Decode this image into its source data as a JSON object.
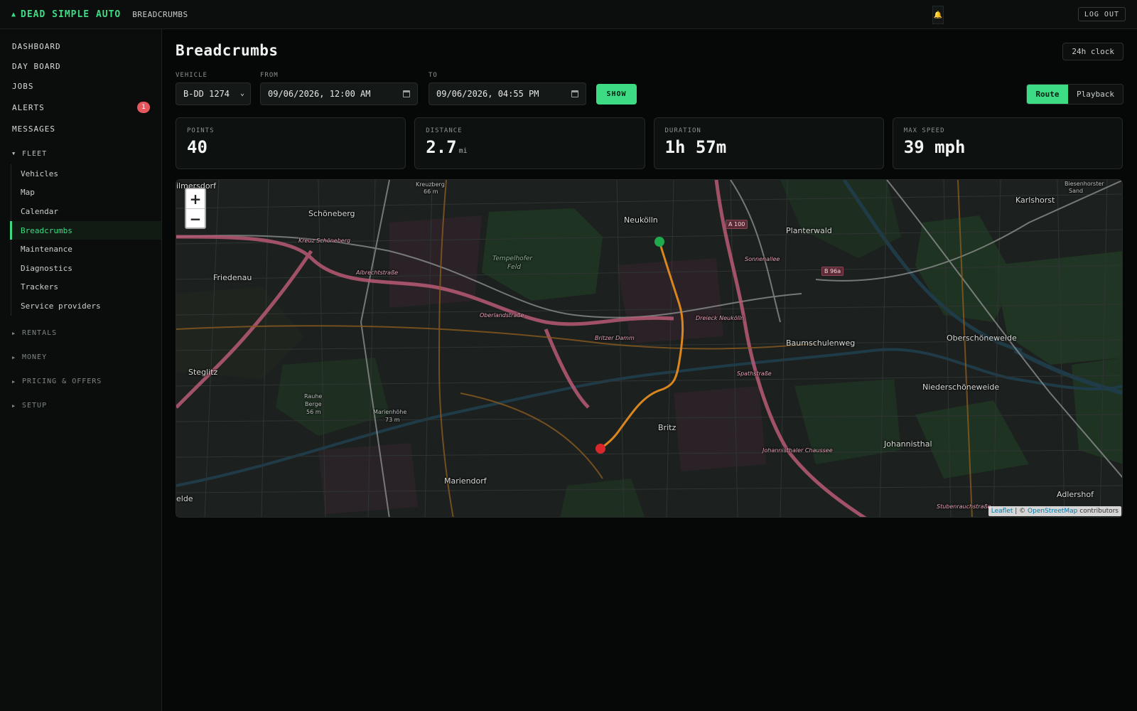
{
  "topbar": {
    "brand_icon": "car-icon",
    "brand": "DEAD SIMPLE AUTO",
    "crumb": "BREADCRUMBS",
    "bell_icon": "bell-icon",
    "logout": "LOG OUT"
  },
  "sidebar": {
    "top_items": [
      {
        "label": "DASHBOARD"
      },
      {
        "label": "DAY BOARD"
      },
      {
        "label": "JOBS"
      },
      {
        "label": "ALERTS",
        "badge": "1"
      },
      {
        "label": "MESSAGES"
      }
    ],
    "fleet": {
      "label": "FLEET",
      "items": [
        "Vehicles",
        "Map",
        "Calendar",
        "Breadcrumbs",
        "Maintenance",
        "Diagnostics",
        "Trackers",
        "Service providers"
      ],
      "active": "Breadcrumbs"
    },
    "groups": [
      "RENTALS",
      "MONEY",
      "PRICING & OFFERS",
      "SETUP"
    ]
  },
  "page": {
    "title": "Breadcrumbs",
    "clock_button": "24h clock",
    "vehicle_label": "VEHICLE",
    "vehicle_value": "B-DD 1274",
    "from_label": "FROM",
    "from_value": "09/06/2026, 12:00 AM",
    "to_label": "TO",
    "to_value": "09/06/2026, 04:55 PM",
    "show_button": "SHOW",
    "view_modes": [
      "Route",
      "Playback"
    ],
    "active_mode": "Route"
  },
  "stats": [
    {
      "label": "POINTS",
      "value": "40",
      "unit": ""
    },
    {
      "label": "DISTANCE",
      "value": "2.7",
      "unit": "mi"
    },
    {
      "label": "DURATION",
      "value": "1h 57m",
      "unit": ""
    },
    {
      "label": "MAX SPEED",
      "value": "39 mph",
      "unit": ""
    }
  ],
  "map": {
    "zoom_in": "+",
    "zoom_out": "−",
    "attribution_leaflet": "Leaflet",
    "attribution_sep": " | © ",
    "attribution_osm": "OpenStreetMap",
    "attribution_tail": " contributors",
    "route_color": "#d9861f",
    "start_color": "#1faa4e",
    "end_color": "#d9282c",
    "places": {
      "wilmersdorf": "ilmersdorf",
      "kreuzberg": "Kreuzberg",
      "kreuzberg_h": "66 m",
      "schoeneberg": "Schöneberg",
      "neukoelln": "Neukölln",
      "a100": "A 100",
      "planterwald": "Planterwald",
      "karlshorst": "Karlshorst",
      "biesenhorster": "Biesenhorster",
      "sand": "Sand",
      "friedenau": "Friedenau",
      "tempelhofer": "Tempelhofer",
      "feld": "Feld",
      "b96a": "B 96a",
      "baumschulenweg": "Baumschulenweg",
      "oberschoeneweide": "Oberschöneweide",
      "steglitz": "Steglitz",
      "niederschoeneweide": "Niederschöneweide",
      "britz": "Britz",
      "johannisthal": "Johannisthal",
      "mariendorf": "Mariendorf",
      "adlershof": "Adlershof",
      "elde": "elde",
      "rauhe": "Rauhe",
      "berge": "Berge",
      "rauhe_h": "56 m",
      "marienhoehe": "Marienhöhe",
      "marienhoehe_h": "73 m",
      "kreuz_schoeneberg": "Kreuz Schöneberg",
      "albrechtstr": "Albrechtstraße",
      "oberlandstr": "Oberlandstraße",
      "britzer_damm": "Britzer Damm",
      "dreieck_neukoelln": "Dreieck Neukölln",
      "sonnenallee": "Sonnenallee",
      "spathstr": "Spathstraße",
      "johannisthaler": "Johannisthaler Chaussee",
      "stubenrauch": "Stubenrauchstraße"
    }
  }
}
